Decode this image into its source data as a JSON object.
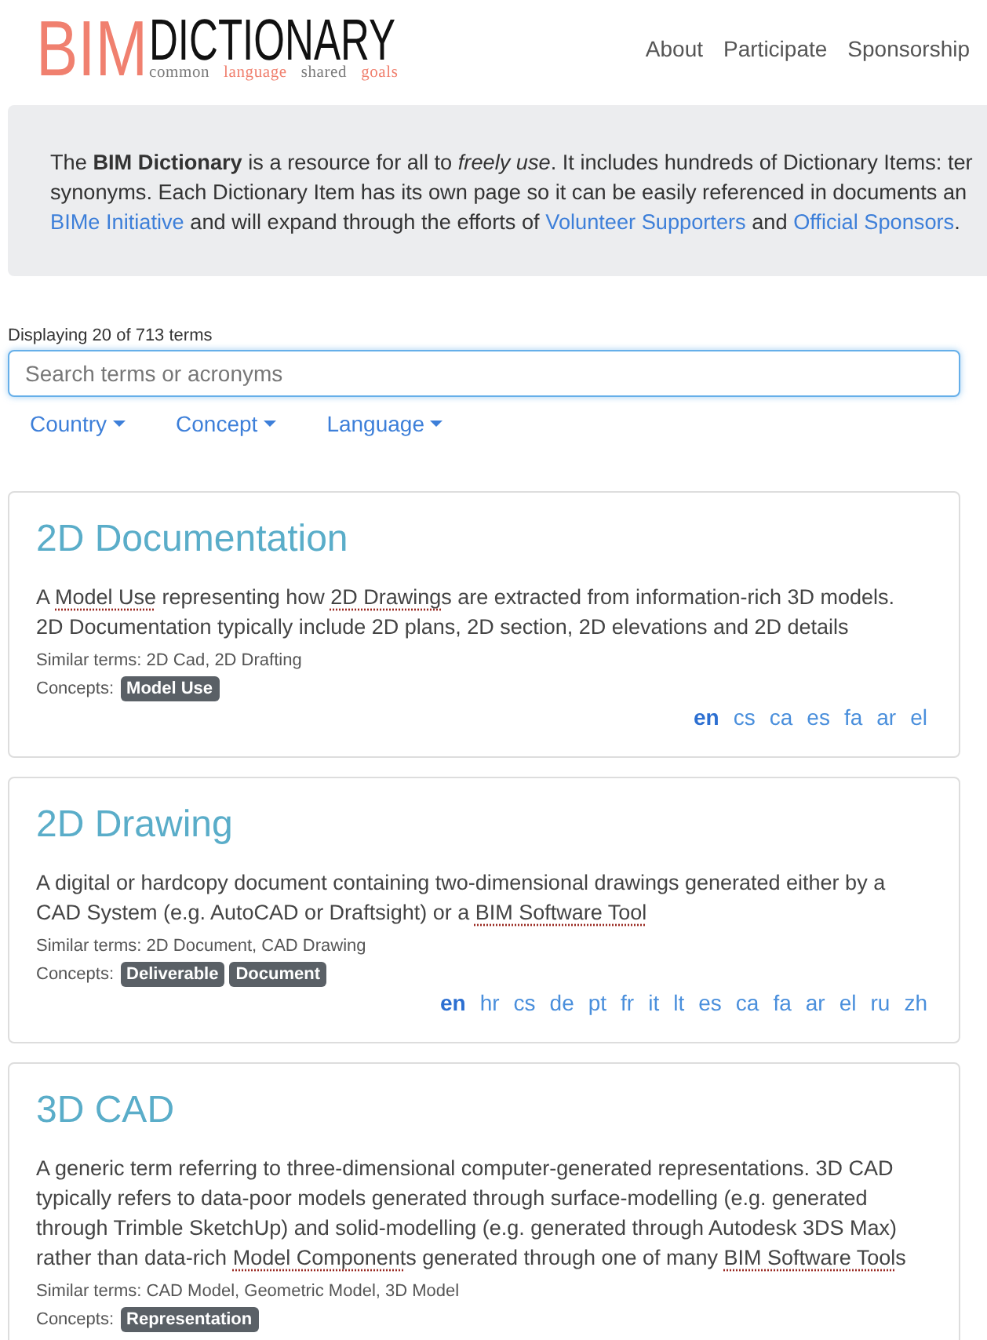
{
  "header": {
    "logo": {
      "mark": "BIM",
      "wordmark": "DICTIONARY",
      "tagline": [
        {
          "text": "common",
          "color": "#7a7a7a"
        },
        {
          "text": "language",
          "color": "#f0806f"
        },
        {
          "text": "shared",
          "color": "#7a7a7a"
        },
        {
          "text": "goals",
          "color": "#f0806f"
        }
      ]
    },
    "nav": [
      "About",
      "Participate",
      "Sponsorship"
    ]
  },
  "intro": {
    "lines": [
      [
        {
          "kind": "text",
          "text": "The **BIM Dictionary** is a resource for all to *freely use*. It includes hundreds of Dictionary Items: ter"
        }
      ],
      [
        {
          "kind": "text",
          "text": "synonyms. Each Dictionary Item has its own page so it can be easily referenced in documents an"
        }
      ],
      [
        {
          "kind": "link",
          "text": "BIMe Initiative"
        },
        {
          "kind": "text",
          "text": " and will expand through the efforts of "
        },
        {
          "kind": "link",
          "text": "Volunteer Supporters"
        },
        {
          "kind": "text",
          "text": " and "
        },
        {
          "kind": "link",
          "text": "Official Sponsors"
        },
        {
          "kind": "text",
          "text": "."
        }
      ]
    ]
  },
  "results_count": "Displaying 20 of 713 terms",
  "search": {
    "placeholder": "Search terms or acronyms"
  },
  "filters": [
    "Country",
    "Concept",
    "Language"
  ],
  "terms": [
    {
      "title": "2D Documentation",
      "description": [
        {
          "kind": "text",
          "text": "A "
        },
        {
          "kind": "link",
          "text": "Model Use"
        },
        {
          "kind": "text",
          "text": " representing how "
        },
        {
          "kind": "link",
          "text": "2D Drawing"
        },
        {
          "kind": "text",
          "text": "s are extracted from information-rich 3D models. 2D Documentation typically include 2D plans, 2D section, 2D elevations and 2D details"
        }
      ],
      "similar_terms": "Similar terms: 2D Cad, 2D Drafting",
      "concepts_label": "Concepts:",
      "concepts": [
        "Model Use"
      ],
      "languages": [
        {
          "code": "en",
          "selected": true
        },
        {
          "code": "cs",
          "selected": false
        },
        {
          "code": "ca",
          "selected": false
        },
        {
          "code": "es",
          "selected": false
        },
        {
          "code": "fa",
          "selected": false
        },
        {
          "code": "ar",
          "selected": false
        },
        {
          "code": "el",
          "selected": false
        }
      ]
    },
    {
      "title": "2D Drawing",
      "description": [
        {
          "kind": "text",
          "text": "A digital or hardcopy document containing two-dimensional drawings generated either by a CAD System (e.g. AutoCAD or Draftsight) or a "
        },
        {
          "kind": "link",
          "text": "BIM Software Tool"
        }
      ],
      "similar_terms": "Similar terms: 2D Document, CAD Drawing",
      "concepts_label": "Concepts:",
      "concepts": [
        "Deliverable",
        "Document"
      ],
      "languages": [
        {
          "code": "en",
          "selected": true
        },
        {
          "code": "hr",
          "selected": false
        },
        {
          "code": "cs",
          "selected": false
        },
        {
          "code": "de",
          "selected": false
        },
        {
          "code": "pt",
          "selected": false
        },
        {
          "code": "fr",
          "selected": false
        },
        {
          "code": "it",
          "selected": false
        },
        {
          "code": "lt",
          "selected": false
        },
        {
          "code": "es",
          "selected": false
        },
        {
          "code": "ca",
          "selected": false
        },
        {
          "code": "fa",
          "selected": false
        },
        {
          "code": "ar",
          "selected": false
        },
        {
          "code": "el",
          "selected": false
        },
        {
          "code": "ru",
          "selected": false
        },
        {
          "code": "zh",
          "selected": false
        }
      ]
    },
    {
      "title": "3D CAD",
      "description": [
        {
          "kind": "text",
          "text": "A generic term referring to three-dimensional computer-generated representations. 3D CAD typically refers to data-poor models generated through surface-modelling (e.g. generated through Trimble SketchUp) and solid-modelling (e.g. generated through Autodesk 3DS Max) rather than data-rich "
        },
        {
          "kind": "link",
          "text": "Model Component"
        },
        {
          "kind": "text",
          "text": "s generated through one of many "
        },
        {
          "kind": "link",
          "text": "BIM Software Tool"
        },
        {
          "kind": "text",
          "text": "s"
        }
      ],
      "similar_terms": "Similar terms: CAD Model, Geometric Model, 3D Model",
      "concepts_label": "Concepts:",
      "concepts": [
        "Representation"
      ]
    }
  ]
}
